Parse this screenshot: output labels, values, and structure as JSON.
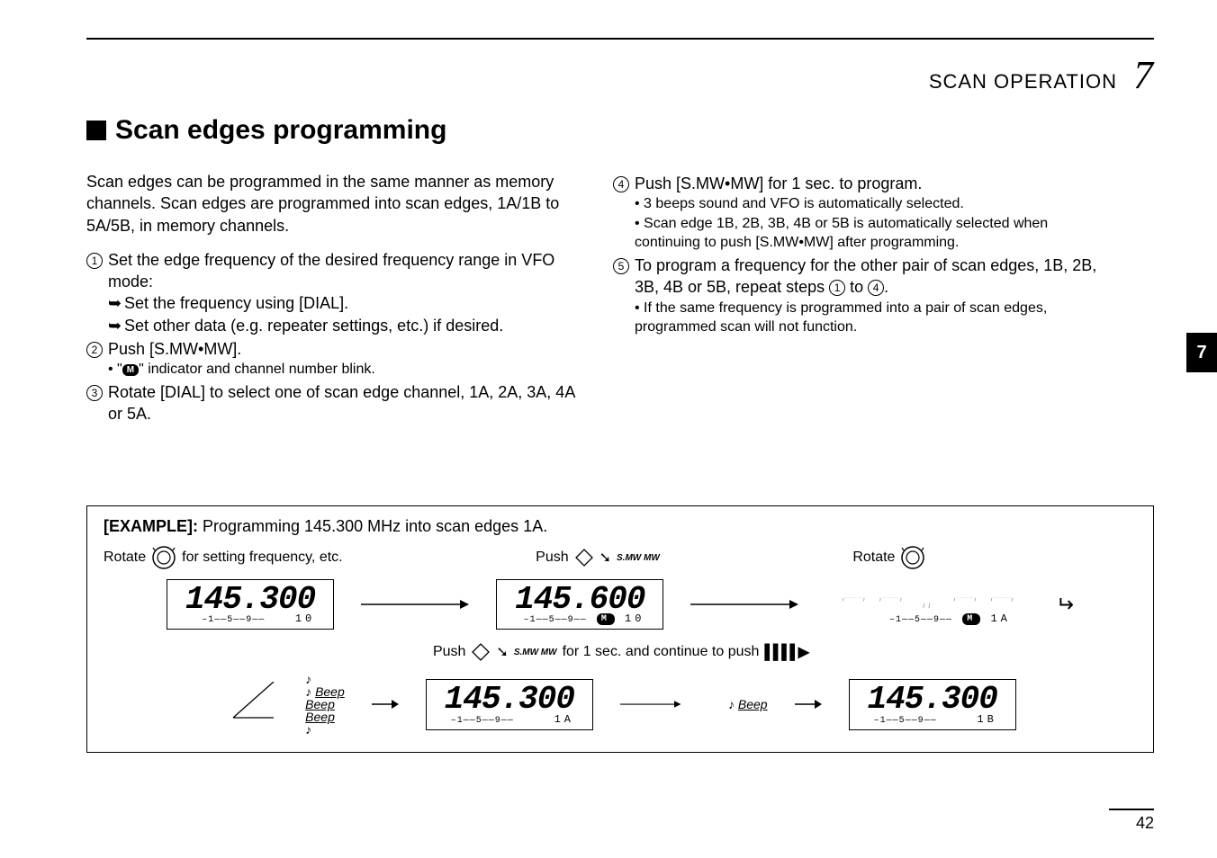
{
  "header": {
    "section": "SCAN OPERATION",
    "chapter": "7"
  },
  "title": "Scan edges programming",
  "side_tab": "7",
  "page_number": "42",
  "left_column": {
    "intro": "Scan edges can be programmed in the same manner as memory channels. Scan edges are programmed into scan edges, 1A/1B to 5A/5B, in memory channels.",
    "steps": {
      "s1_text": "Set the edge frequency of the desired frequency range in VFO mode:",
      "s1_sub_a": "Set the frequency using [DIAL].",
      "s1_sub_b": "Set other data (e.g. repeater settings, etc.) if desired.",
      "s2_text": "Push [S.MW•MW].",
      "s2_sub": "indicator and channel number blink.",
      "s3_text": "Rotate [DIAL] to select one of scan edge channel, 1A, 2A, 3A, 4A or 5A."
    }
  },
  "right_column": {
    "s4_text": "Push [S.MW•MW] for 1 sec. to program.",
    "s4_sub_a": "3 beeps sound and VFO is automatically selected.",
    "s4_sub_b": "Scan edge 1B, 2B, 3B, 4B or 5B is automatically selected when continuing to push [S.MW•MW] after programming.",
    "s5_text": "To program a frequency for the other pair of scan edges, 1B, 2B, 3B, 4B or 5B, repeat steps ",
    "s5_to": " to ",
    "s5_end": ".",
    "s5_sub": "If the same frequency is programmed into a pair of scan edges, programmed scan will not function."
  },
  "example": {
    "title_label": "[EXAMPLE]:",
    "title_text": " Programming 145.300 MHz into scan edges 1A.",
    "rotate_label": "Rotate",
    "rotate_suffix": "for setting frequency, etc.",
    "push_label": "Push",
    "smw_label": "S.MW MW",
    "push_mid": " for 1 sec. and continue to push ",
    "beep3": "Beep\nBeep\nBeep",
    "beep1": "Beep",
    "lcd": {
      "freq1": "145.300",
      "ch1": "10",
      "freq2": "145.600",
      "ch2": "10",
      "ch3": "1A",
      "freq4": "145.300",
      "ch4": "1A",
      "freq5": "145.300",
      "ch5": "1B",
      "sbar": "–1——5——9——"
    }
  }
}
